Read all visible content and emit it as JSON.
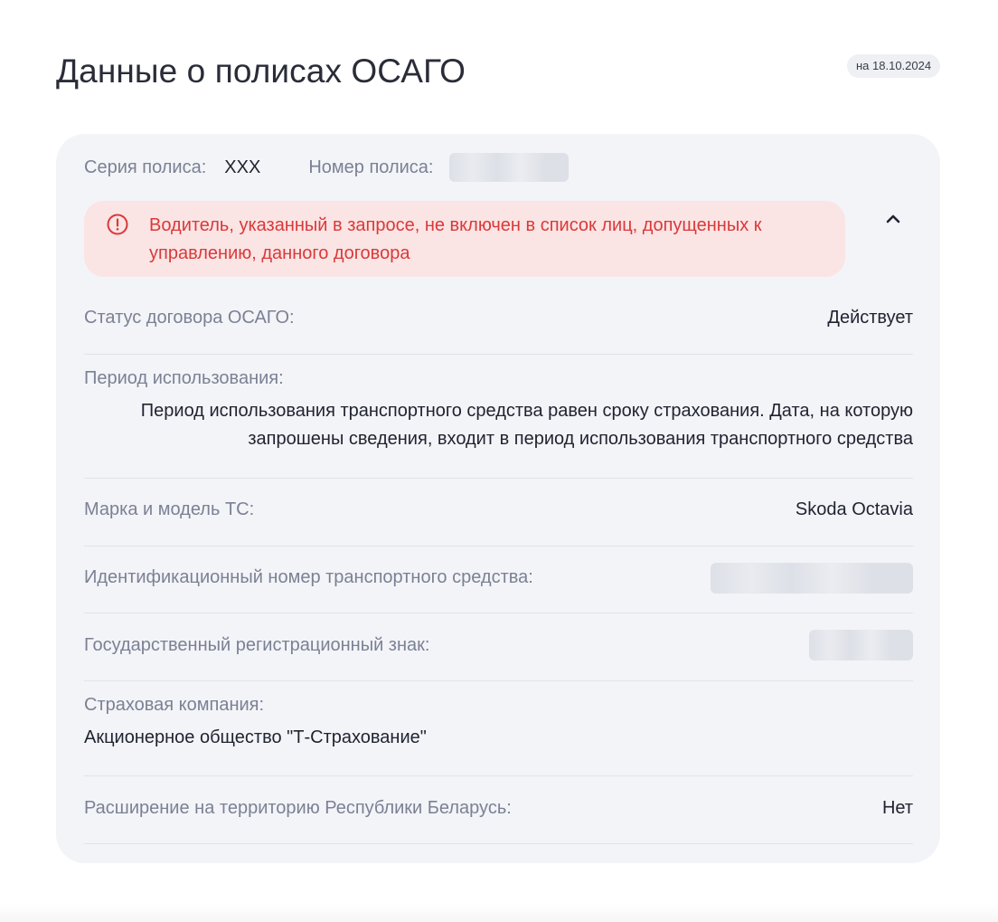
{
  "header": {
    "title": "Данные о полисах ОСАГО",
    "date_badge": "на 18.10.2024"
  },
  "policy": {
    "series_label": "Серия полиса:",
    "series_value": "XXX",
    "number_label": "Номер полиса:"
  },
  "alert": {
    "icon": "exclamation-circle-icon",
    "text": "Водитель, указанный в запросе, не включен в список лиц, допущенных к управлению, данного договора",
    "color": "#d9393a",
    "background": "#fbe4e4"
  },
  "collapse_icon": "chevron-up-icon",
  "details": {
    "status": {
      "label": "Статус договора ОСАГО:",
      "value": "Действует"
    },
    "period": {
      "label": "Период использования:",
      "value": "Период использования транспортного средства равен сроку страхования. Дата, на которую запрошены сведения, входит в период использования транспортного средства"
    },
    "make_model": {
      "label": "Марка и модель ТС:",
      "value": "Skoda Octavia"
    },
    "vin": {
      "label": "Идентификационный номер транспортного средства:"
    },
    "plate": {
      "label": "Государственный регистрационный знак:"
    },
    "insurer": {
      "label": "Страховая компания:",
      "value": "Акционерное общество \"Т-Страхование\""
    },
    "belarus": {
      "label": "Расширение на территорию Республики Беларусь:",
      "value": "Нет"
    }
  }
}
